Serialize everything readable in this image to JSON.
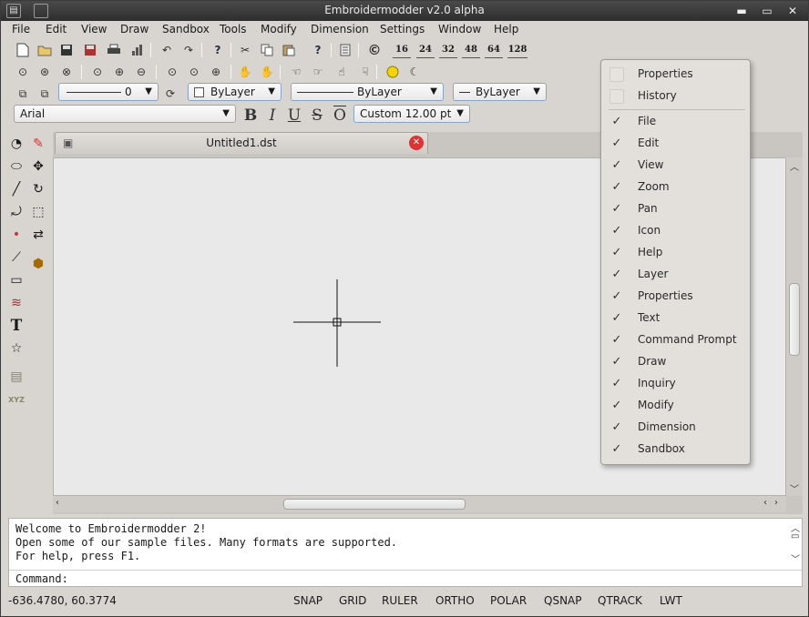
{
  "window": {
    "title": "Embroidermodder v2.0 alpha"
  },
  "menu": [
    "File",
    "Edit",
    "View",
    "Draw",
    "Sandbox",
    "Tools",
    "Modify",
    "Dimension",
    "Settings",
    "Window",
    "Help"
  ],
  "toolbar": {
    "numbers": [
      "16",
      "24",
      "32",
      "48",
      "64",
      "128"
    ],
    "layer_combo": "0",
    "color_combo": "ByLayer",
    "linetype_combo": "ByLayer",
    "lineweight_combo": "ByLayer",
    "font_combo": "Arial",
    "text_bold": "B",
    "text_italic": "I",
    "text_underline": "U",
    "text_strike": "S",
    "text_overline": "O",
    "font_size_combo": "Custom 12.00 pt"
  },
  "document": {
    "tab_title": "Untitled1.dst"
  },
  "command": {
    "lines": [
      "Welcome to Embroidermodder 2!",
      "Open some of our sample files. Many formats are supported.",
      "For help, press F1."
    ],
    "prompt": "Command:"
  },
  "status": {
    "coords": "-636.4780, 60.3774",
    "toggles": [
      "SNAP",
      "GRID",
      "RULER",
      "ORTHO",
      "POLAR",
      "QSNAP",
      "QTRACK",
      "LWT"
    ]
  },
  "context_menu": {
    "unchecked": [
      "Properties",
      "History"
    ],
    "checked": [
      "File",
      "Edit",
      "View",
      "Zoom",
      "Pan",
      "Icon",
      "Help",
      "Layer",
      "Properties",
      "Text",
      "Command Prompt",
      "Draw",
      "Inquiry",
      "Modify",
      "Dimension",
      "Sandbox"
    ]
  },
  "colors": {
    "canvas": "#e9e9e9",
    "chrome": "#d8d5d1",
    "titlebar": "#333333",
    "close_tab": "#dd3333"
  }
}
